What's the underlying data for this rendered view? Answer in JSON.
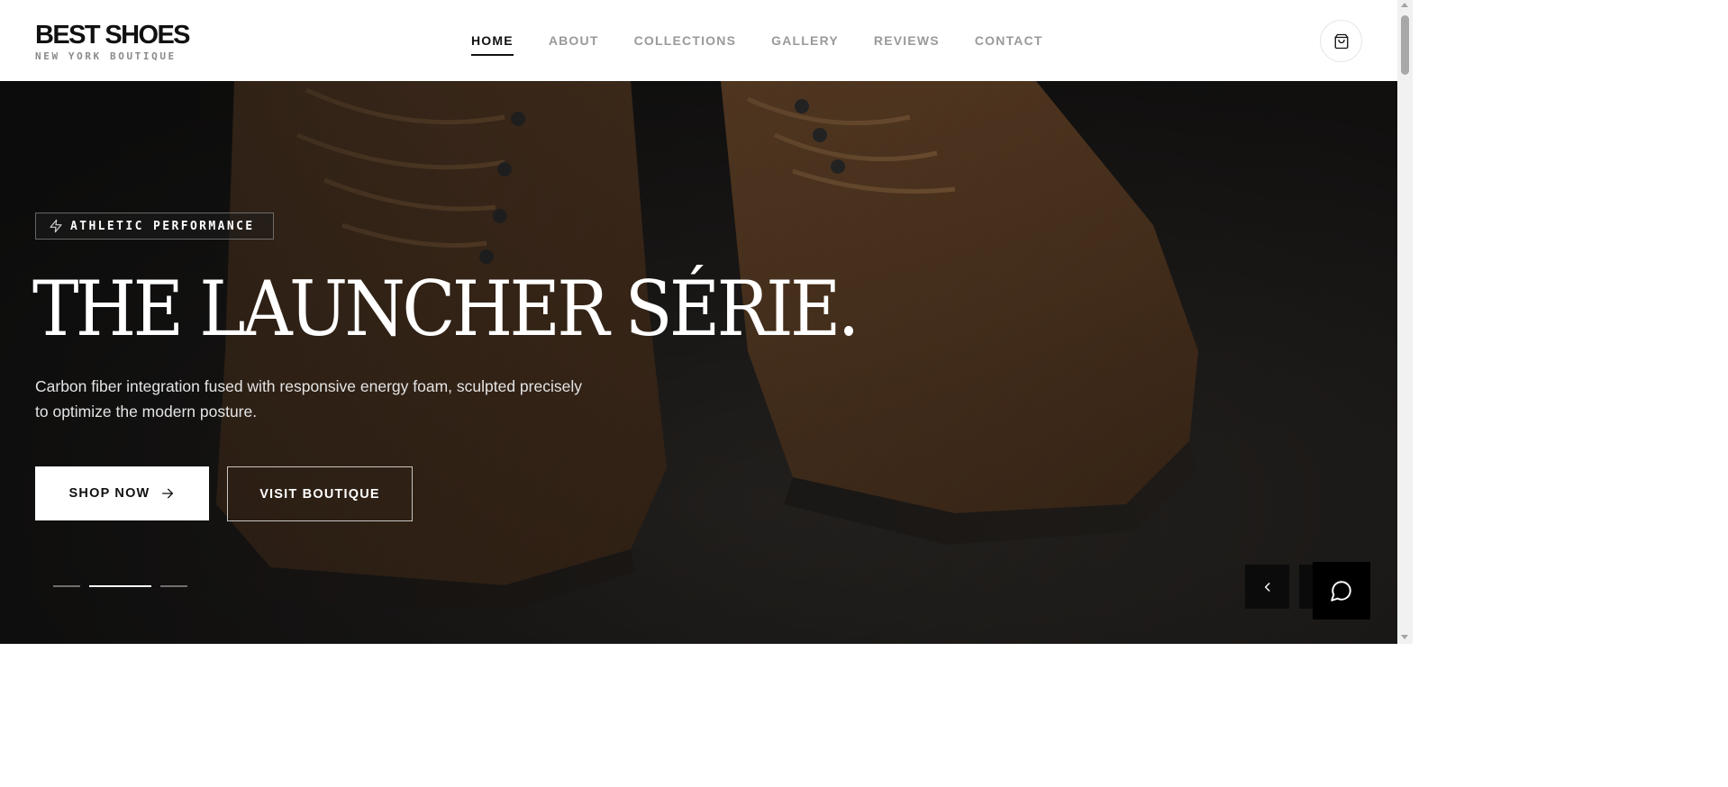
{
  "brand": {
    "name": "BEST SHOES",
    "tagline": "NEW YORK BOUTIQUE"
  },
  "nav": {
    "items": [
      {
        "label": "HOME",
        "active": true
      },
      {
        "label": "ABOUT",
        "active": false
      },
      {
        "label": "COLLECTIONS",
        "active": false
      },
      {
        "label": "GALLERY",
        "active": false
      },
      {
        "label": "REVIEWS",
        "active": false
      },
      {
        "label": "CONTACT",
        "active": false
      }
    ],
    "cart_icon": "shopping-bag-icon"
  },
  "hero": {
    "badge_icon": "lightning-icon",
    "badge": "ATHLETIC PERFORMANCE",
    "title": "THE LAUNCHER SÉRIE.",
    "description": "Carbon fiber integration fused with responsive energy foam, sculpted precisely to optimize the modern posture.",
    "primary_button": "SHOP NOW",
    "primary_button_icon": "arrow-right-icon",
    "secondary_button": "VISIT BOUTIQUE",
    "slides_total": 3,
    "active_slide": 2,
    "prev_icon": "chevron-left-icon",
    "chat_icon": "chat-bubble-icon"
  },
  "colors": {
    "primary": "#111111",
    "nav_inactive": "#9a9a9a",
    "hero_text": "#ffffff"
  }
}
